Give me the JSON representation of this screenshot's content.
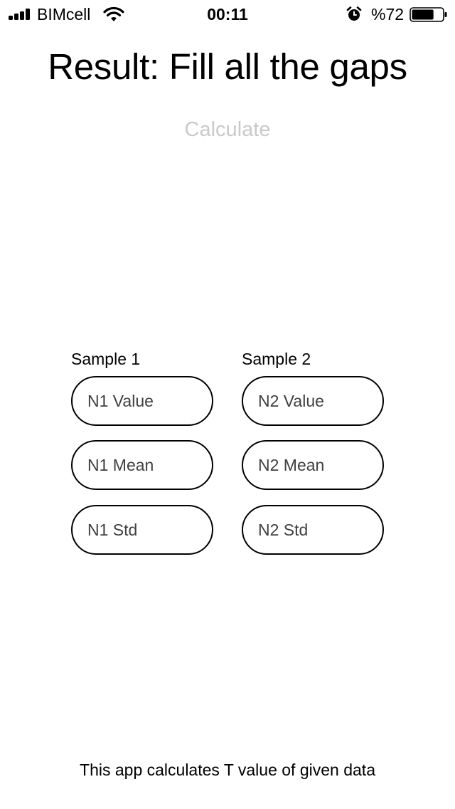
{
  "status_bar": {
    "carrier": "BIMcell",
    "time": "00:11",
    "battery_percent": "%72",
    "battery_level": 0.72,
    "icons": [
      "signal-icon",
      "wifi-icon",
      "alarm-icon",
      "battery-icon"
    ]
  },
  "title": "Result: Fill all the gaps",
  "calculate_label": "Calculate",
  "sample1": {
    "label": "Sample 1",
    "value_placeholder": "N1 Value",
    "mean_placeholder": "N1 Mean",
    "std_placeholder": "N1 Std"
  },
  "sample2": {
    "label": "Sample 2",
    "value_placeholder": "N2 Value",
    "mean_placeholder": "N2 Mean",
    "std_placeholder": "N2 Std"
  },
  "footer": "This app calculates T value of given data",
  "colors": {
    "text": "#000000",
    "disabled_button": "#c9c9ce",
    "background": "#ffffff"
  }
}
